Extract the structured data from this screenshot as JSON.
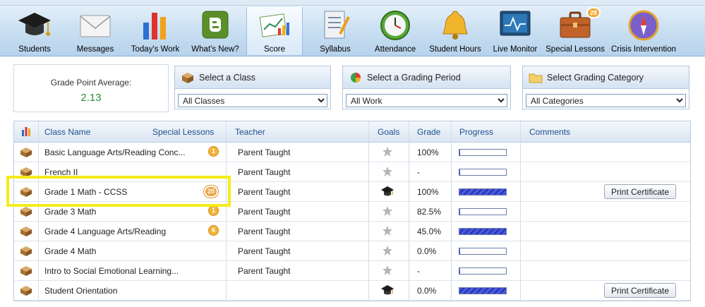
{
  "toolbar": {
    "items": [
      {
        "label": "Students",
        "icon": "graduation-cap-icon"
      },
      {
        "label": "Messages",
        "icon": "envelope-icon"
      },
      {
        "label": "Today's Work",
        "icon": "bar-chart-icon"
      },
      {
        "label": "What's New?",
        "icon": "blogger-icon"
      },
      {
        "label": "Score",
        "icon": "score-chart-icon"
      },
      {
        "label": "Syllabus",
        "icon": "syllabus-icon"
      },
      {
        "label": "Attendance",
        "icon": "clock-icon"
      },
      {
        "label": "Student Hours",
        "icon": "bell-icon"
      },
      {
        "label": "Live Monitor",
        "icon": "monitor-icon"
      },
      {
        "label": "Special Lessons",
        "icon": "briefcase-icon",
        "badge": "28"
      },
      {
        "label": "Crisis Intervention",
        "icon": "compass-icon"
      }
    ],
    "active": "Score"
  },
  "gpa": {
    "label": "Grade Point Average:",
    "value": "2.13"
  },
  "filters": {
    "class": {
      "title": "Select a Class",
      "value": "All Classes"
    },
    "period": {
      "title": "Select a Grading Period",
      "value": "All Work"
    },
    "category": {
      "title": "Select Grading Category",
      "value": "All Categories"
    }
  },
  "table": {
    "headers": {
      "class_name": "Class Name",
      "special_lessons": "Special Lessons",
      "teacher": "Teacher",
      "goals": "Goals",
      "grade": "Grade",
      "progress": "Progress",
      "comments": "Comments"
    },
    "rows": [
      {
        "class_name": "Basic Language Arts/Reading Conc...",
        "lessons": "1",
        "teacher": "Parent Taught",
        "goal": "star",
        "grade": "100%",
        "progress": 0.02,
        "certificate": ""
      },
      {
        "class_name": "French II",
        "lessons": "",
        "teacher": "Parent Taught",
        "goal": "star",
        "grade": "-",
        "progress": 0.02,
        "certificate": ""
      },
      {
        "class_name": "Grade 1 Math - CCSS",
        "lessons": "20",
        "teacher": "Parent Taught",
        "goal": "cap",
        "grade": "100%",
        "progress": 1.0,
        "certificate": "Print Certificate"
      },
      {
        "class_name": "Grade 3 Math",
        "lessons": "1",
        "teacher": "Parent Taught",
        "goal": "star",
        "grade": "82.5%",
        "progress": 0.02,
        "certificate": ""
      },
      {
        "class_name": "Grade 4 Language Arts/Reading",
        "lessons": "6",
        "teacher": "Parent Taught",
        "goal": "star",
        "grade": "45.0%",
        "progress": 1.0,
        "certificate": ""
      },
      {
        "class_name": "Grade 4 Math",
        "lessons": "",
        "teacher": "Parent Taught",
        "goal": "star",
        "grade": "0.0%",
        "progress": 0.02,
        "certificate": ""
      },
      {
        "class_name": "Intro to Social Emotional Learning...",
        "lessons": "",
        "teacher": "Parent Taught",
        "goal": "star",
        "grade": "-",
        "progress": 0.02,
        "certificate": ""
      },
      {
        "class_name": "Student Orientation",
        "lessons": "",
        "teacher": "",
        "goal": "cap",
        "grade": "0.0%",
        "progress": 1.0,
        "certificate": "Print Certificate"
      }
    ]
  },
  "colors": {
    "gpa": "#2a8c3a",
    "header_text": "#1f4f8c",
    "highlight": "#f4ec1a",
    "progress": "#3b49d0"
  }
}
